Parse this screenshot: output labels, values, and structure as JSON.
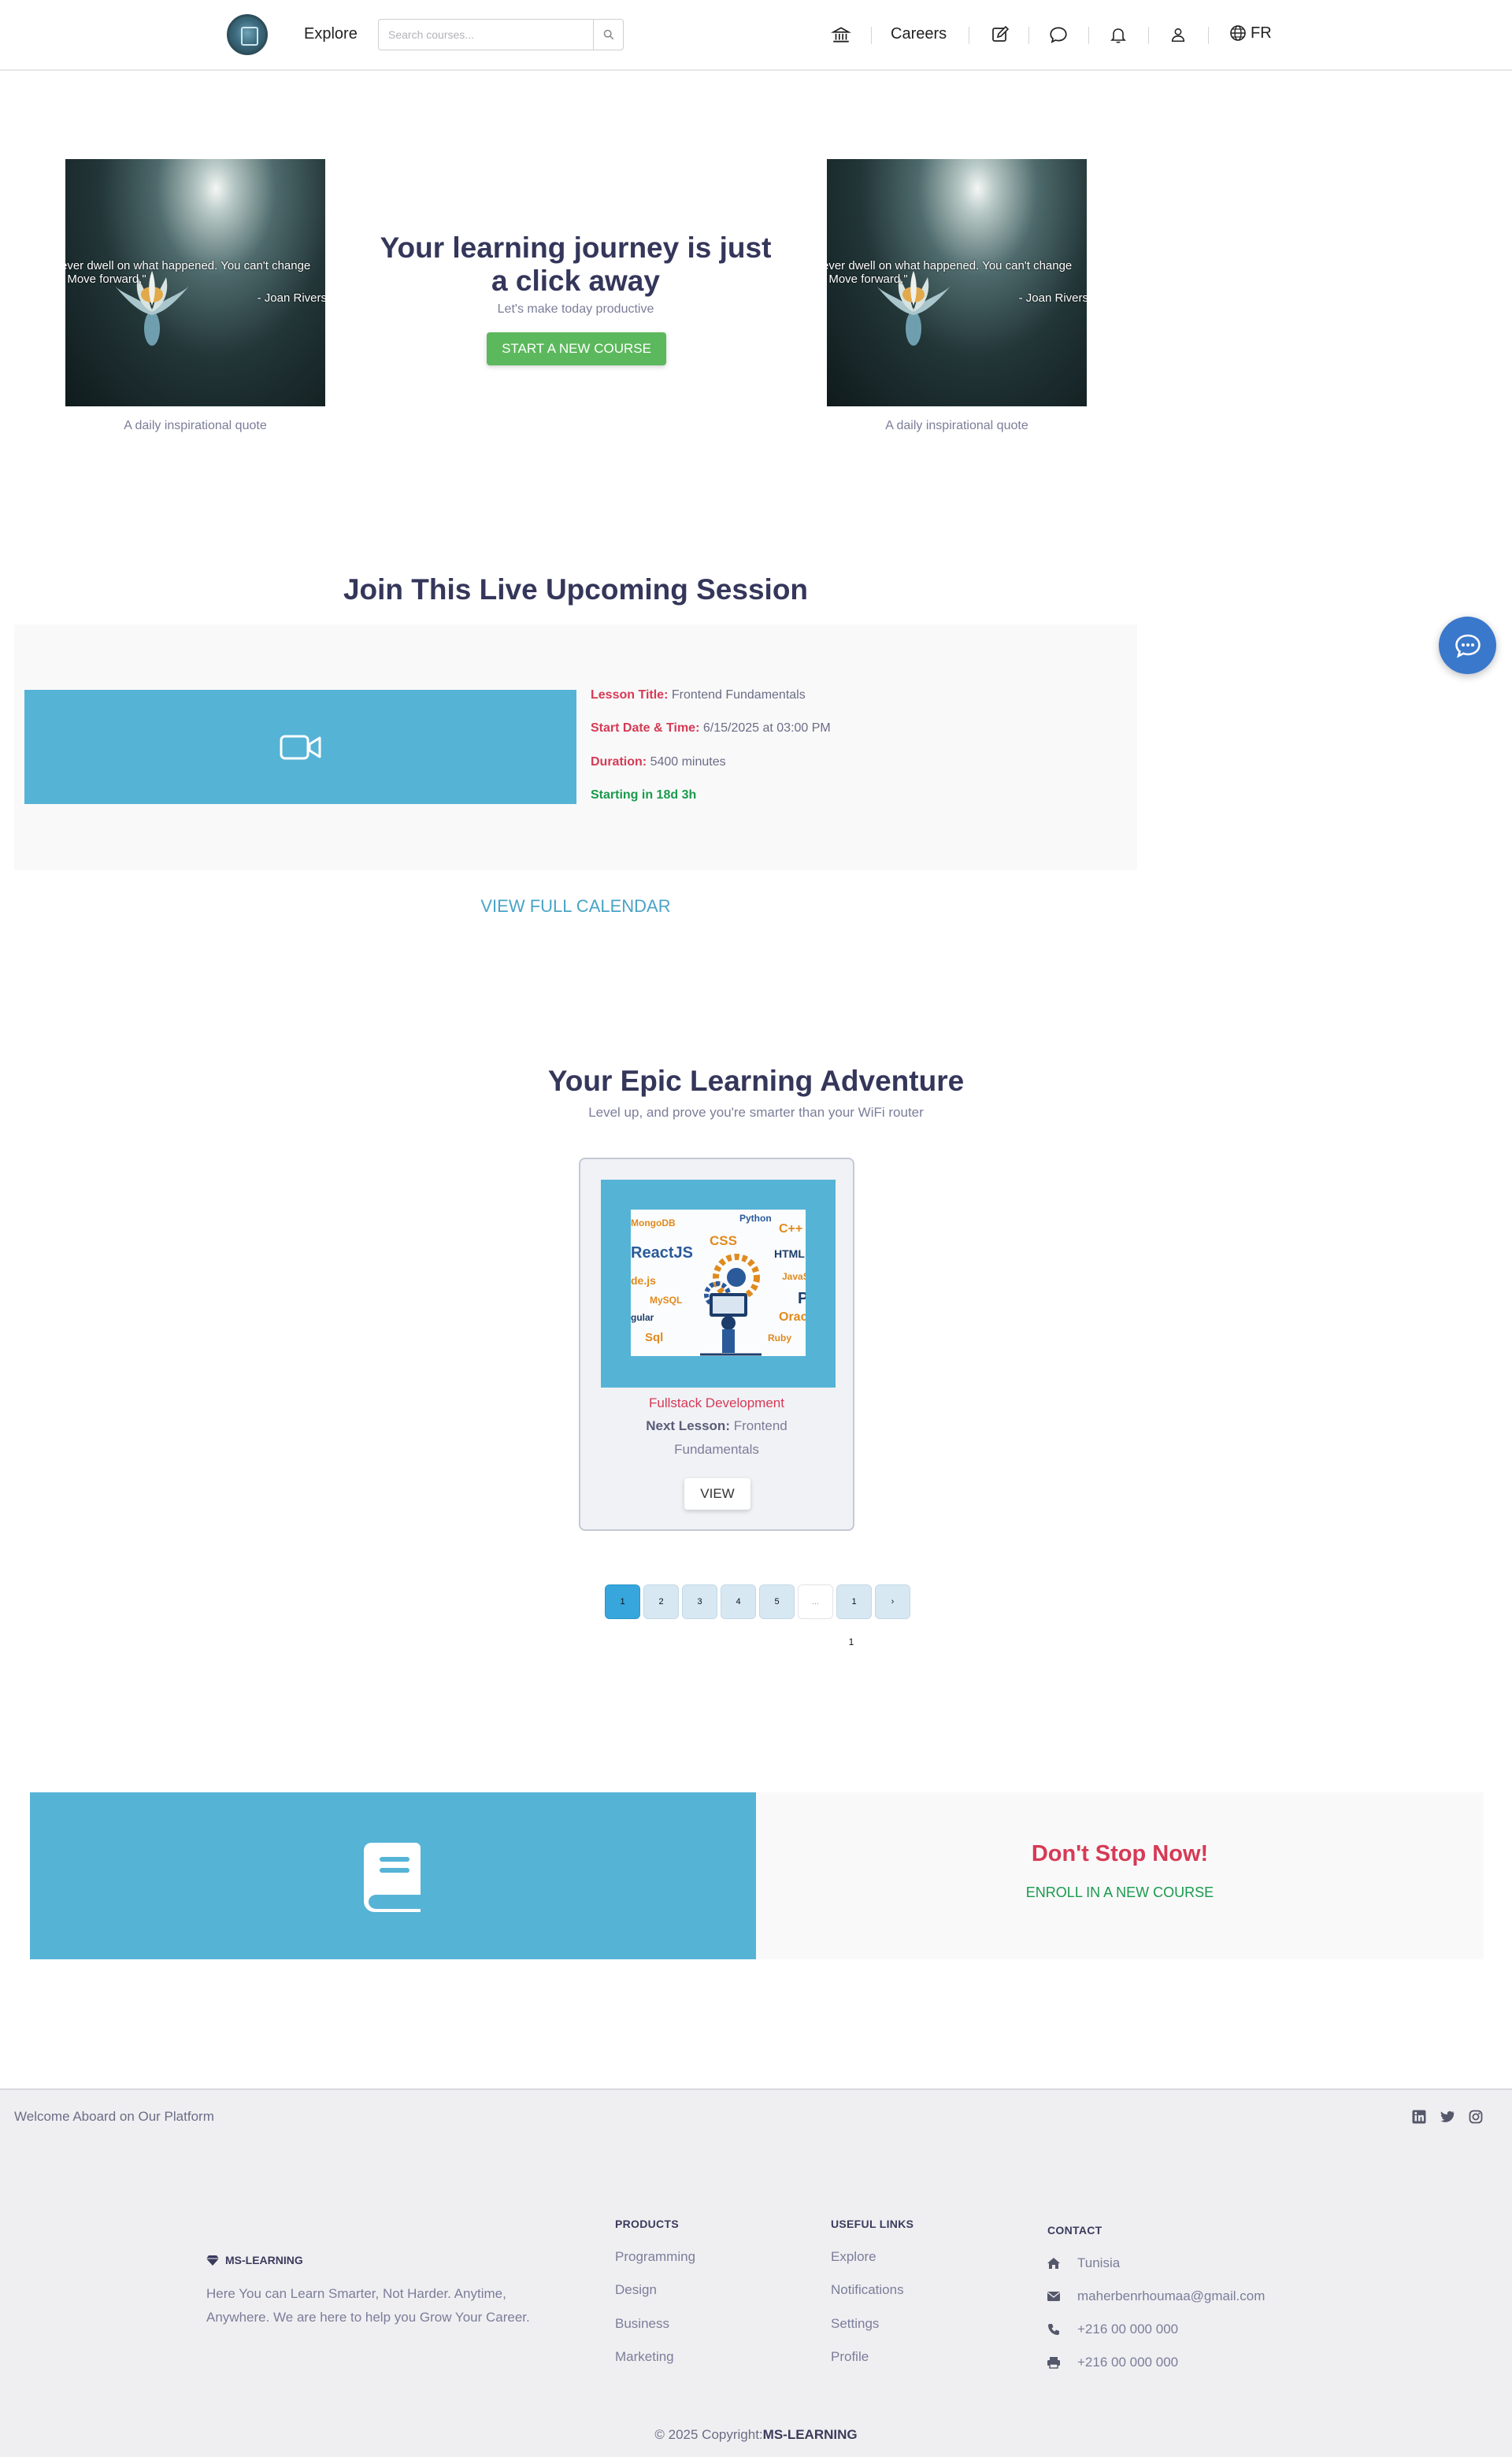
{
  "header": {
    "explore_label": "Explore",
    "search_placeholder": "Search courses...",
    "careers_label": "Careers",
    "language_label": "FR",
    "icons": [
      "institution-icon",
      "edit-icon",
      "chat-icon",
      "bell-icon",
      "user-icon",
      "globe-icon"
    ]
  },
  "hero": {
    "quote_text_line1": "ever dwell on what happened. You can't change",
    "quote_text_line2": "Move forward.\"",
    "quote_author": "- Joan Rivers",
    "quote_caption": "A daily inspirational quote",
    "title": "Your learning journey is just a click away",
    "subtitle": "Let's make today productive",
    "cta_label": "START A NEW COURSE"
  },
  "live_session": {
    "title": "Join This Live Upcoming Session",
    "lesson_title_label": "Lesson Title:",
    "lesson_title": "Frontend Fundamentals",
    "start_label": "Start Date & Time:",
    "start_value": "6/15/2025 at 03:00 PM",
    "duration_label": "Duration:",
    "duration_value": "5400 minutes",
    "countdown": "Starting in 18d 3h",
    "calendar_link": "VIEW FULL CALENDAR"
  },
  "adventure": {
    "title": "Your Epic Learning Adventure",
    "subtitle": "Level up, and prove you're smarter than your WiFi router",
    "course": {
      "name": "Fullstack Development",
      "next_label": "Next Lesson:",
      "next_value": "Frontend Fundamentals",
      "view_label": "VIEW",
      "thumb_tags": [
        "MongoDB",
        "Python",
        "C++",
        "CSS",
        "ReactJS",
        "HTML",
        "de.js",
        "JavaS",
        "MySQL",
        "P",
        "gular",
        "Orac",
        "Sql",
        "Ruby"
      ]
    },
    "pagination": {
      "pages": [
        "1",
        "2",
        "3",
        "4",
        "5",
        "...",
        "1",
        "›"
      ],
      "active_page": "1",
      "count_label": "1"
    }
  },
  "banner": {
    "title": "Don't Stop Now!",
    "link_label": "ENROLL IN A NEW COURSE"
  },
  "footer": {
    "welcome": "Welcome Aboard on Our Platform",
    "social": [
      "linkedin-icon",
      "twitter-icon",
      "instagram-icon"
    ],
    "brand": "MS-LEARNING",
    "description": "Here You can Learn Smarter, Not Harder. Anytime, Anywhere. We are here to help you Grow Your Career.",
    "products_head": "PRODUCTS",
    "products": [
      "Programming",
      "Design",
      "Business",
      "Marketing"
    ],
    "links_head": "USEFUL LINKS",
    "links": [
      "Explore",
      "Notifications",
      "Settings",
      "Profile"
    ],
    "contact_head": "CONTACT",
    "contact_location": "Tunisia",
    "contact_email": "maherbenrhoumaa@gmail.com",
    "contact_phone": "+216 00 000 000",
    "contact_fax": "+216 00 000 000",
    "copyright_prefix": "© 2025 Copyright:",
    "copyright_brand": "MS-LEARNING"
  },
  "colors": {
    "primary_text": "#34365a",
    "accent_blue": "#55b3d6",
    "accent_red": "#d63a55",
    "accent_green": "#1a9a4c",
    "button_green": "#5cb85c",
    "fab_blue": "#3a78cc"
  }
}
